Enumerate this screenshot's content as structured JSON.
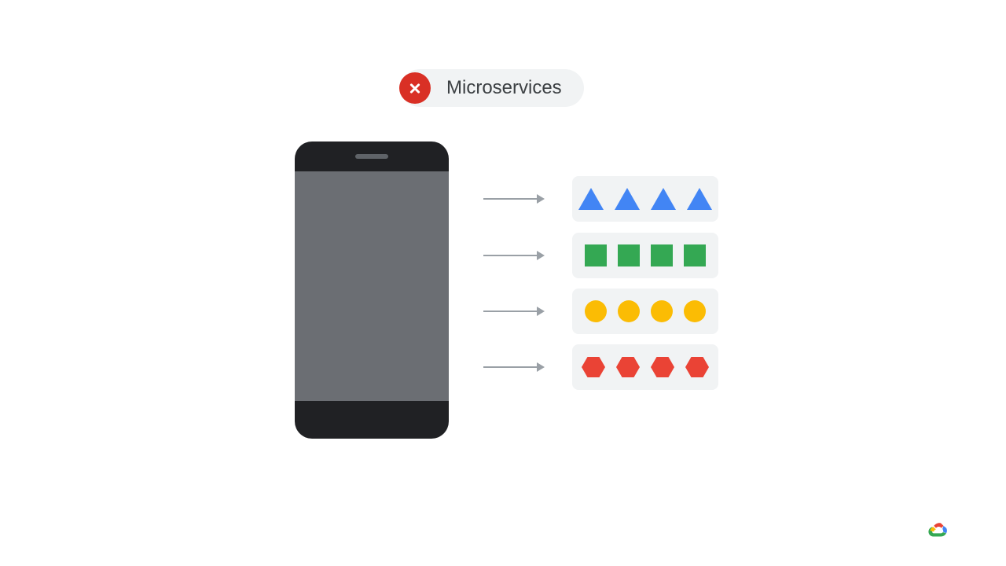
{
  "title": {
    "label": "Microservices",
    "status": "error"
  },
  "services": [
    {
      "shape": "triangle",
      "color": "#4285f4",
      "count": 4
    },
    {
      "shape": "square",
      "color": "#34a853",
      "count": 4
    },
    {
      "shape": "circle",
      "color": "#fbbc04",
      "count": 4
    },
    {
      "shape": "hexagon",
      "color": "#ea4335",
      "count": 4
    }
  ],
  "brand": "google-cloud"
}
